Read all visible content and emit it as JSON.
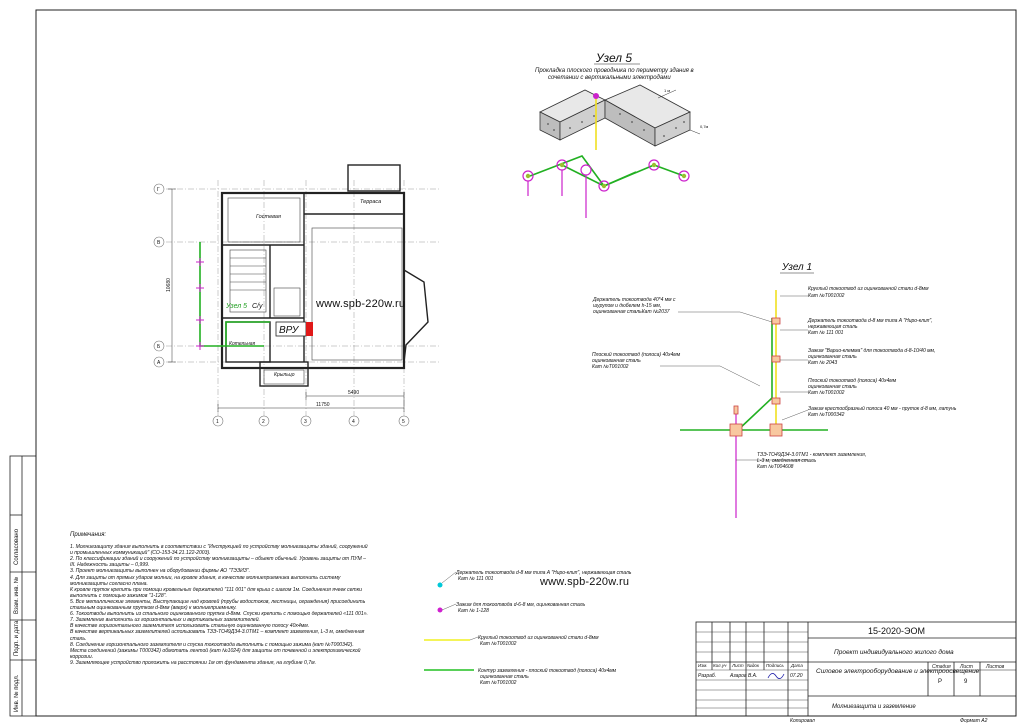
{
  "watermark": "www.spb-220w.ru",
  "node5": {
    "title": "Узел 5",
    "subtitle_line1": "Прокладка плоского проводника по периметру здания в",
    "subtitle_line2": "сочетании с вертикальными электродами",
    "dim_top": "1 м",
    "dim_side": "0,7м"
  },
  "node1": {
    "title": "Узел 1",
    "labels": [
      [
        "Держатель токоотвода 40*4 мм с",
        "шурупом и дюбелем h-15 мм,",
        "оцинкованная стальКат №2037"
      ],
      [
        "Плоский токоотвод (полоса) 40х4мм",
        "оцинкованная сталь",
        "Кат №T001002"
      ],
      [
        "Круглый токоотвод из оцинкованной стали d-8мм",
        "Кат №T001002"
      ],
      [
        "Держатель токоотвода d-8 мм типа A \"Hupo-клип\",",
        "нержавеющая сталь",
        "Кат № 111 001"
      ],
      [
        "Зажим \"Варио-клемма\" для токоотвода d-8-10/40 мм,",
        "оцинкованная сталь",
        "Кат № 2043"
      ],
      [
        "Плоский токоотвод (полоса) 40х4мм",
        "оцинкованная сталь",
        "Кат №T001002"
      ],
      [
        "Зажим крестообразный полоса 40 мм - пруток d-8 мм, латунь",
        "Кат №T000342"
      ],
      [
        "ТЗЭ-ТО49Д34-3.0ТМ1 - комплект заземления,",
        "L-3 м, омедненная сталь",
        "Кат №T004608"
      ]
    ]
  },
  "plan": {
    "room_guest": "Гостевая",
    "room_terrace": "Терраса",
    "room_boiler": "Котельная",
    "room_porch": "Крыльцо",
    "room_bath": "С/у",
    "vru": "ВРУ",
    "node_ref": "Узел 5",
    "dim_vertical": "10680",
    "dim_bottom_total": "11750",
    "dim_bottom_part": "5490",
    "axes_letters": [
      "Г",
      "В",
      "Б",
      "А"
    ],
    "axes_numbers": [
      "1",
      "2",
      "3",
      "4",
      "5"
    ]
  },
  "notes": {
    "heading": "Примечания:",
    "lines": [
      "1. Молниезащиту здания выполнить в соответствии с \"Инструкцией по устройству молниезащиты зданий, сооружений и промышленных коммуникаций\" (СО-153-34.21.122-2003).",
      "2. По классификации зданий и сооружений по устройству молниезащиты – объект обычный. Уровень защиты от ПУМ – III. Надежность защиты – 0,999.",
      "3. Проект молниезащиты выполнен на оборудовании фирмы АО \"ТЭЗИЗ\".",
      "4. Для защиты от прямых ударов молнии, на кровле здания, в качестве молниеприемника выполнить систему молниезащиты согласно плана.",
      "К кровле пруток крепить при помощи кровельных держателей \"111 001\" для крыш с шагом 1м. Соединения ячеек сетки выполнить с помощью зажимов \"1-128\".",
      "5. Все металлические элементы, Выступающие над кровлей (трубы водостоков, лестницы, ограждения) присоединить стальным оцинкованным прутком d-8мм (вверх) к молниеприемнику.",
      "6. Токоотводы выполнить из стального оцинкованного прутка d-8мм. Спуски крепить с помощью держателей «111 001».",
      "7. Заземление выполнить из горизонтальных и вертикальных заземлителей.",
      "В качестве горизонтального заземлителя использовать стальную оцинкованную полосу 40х4мм.",
      "В качестве вертикальных заземлителей использовать ТЗЭ-ТО49Д34-3.0ТМ1 – комплект заземления, L-3 м, омедненная сталь.",
      "8. Соединение горизонтального заземлителя и спуска токоотвода выполнить с помощью зажима (кат №T000342).",
      "Места соединений (зажимы T000342) обмотать лентой (кат №1024) для защиты от почвенной и электрохимической коррозии.",
      "9. Заземляющее устройство проложить на расстоянии 1м от фундамента здания, на глубине 0,7м."
    ]
  },
  "legend": [
    {
      "lines": [
        "Держатель токоотвода d-8 мм типа A \"Hupo-клип\", нержавеющая сталь",
        "Кат № 111 001"
      ],
      "color": "#00c8d8"
    },
    {
      "lines": [
        "Зажим для токоотвода d-6-8 мм, оцинкованная сталь",
        "Кат № 1-128"
      ],
      "color": "#d020d0"
    },
    {
      "lines": [
        "Круглый токоотвод из оцинкованной стали d-8мм",
        "Кат №T001002"
      ],
      "color": "#f0f020"
    },
    {
      "lines": [
        "Контур заземления - плоский токоотвод (полоса) 40х4мм",
        "оцинкованная сталь",
        "Кат №T001002"
      ],
      "color": "#22c022"
    }
  ],
  "title_block": {
    "code": "15-2020-ЭОМ",
    "project": "Проект индивидуального жилого дома",
    "section": "Силовое электрооборудование и электроосвещение",
    "sheet_name": "Молниезащита и заземление",
    "col_headers": [
      "Изм.",
      "Кол.уч",
      "Лист",
      "№док",
      "Подпись",
      "Дата"
    ],
    "role": "Разраб.",
    "author": "Азаров В.А.",
    "date": "07.20",
    "stage_header": "Стадия",
    "sheet_header": "Лист",
    "sheets_header": "Листов",
    "stage": "Р",
    "sheet": "9",
    "copied": "Копировал",
    "format": "Формат А2"
  },
  "side_stamp": [
    "Согласовано",
    "Взам. инв. №",
    "Подп. и дата",
    "Инв. № подл."
  ]
}
